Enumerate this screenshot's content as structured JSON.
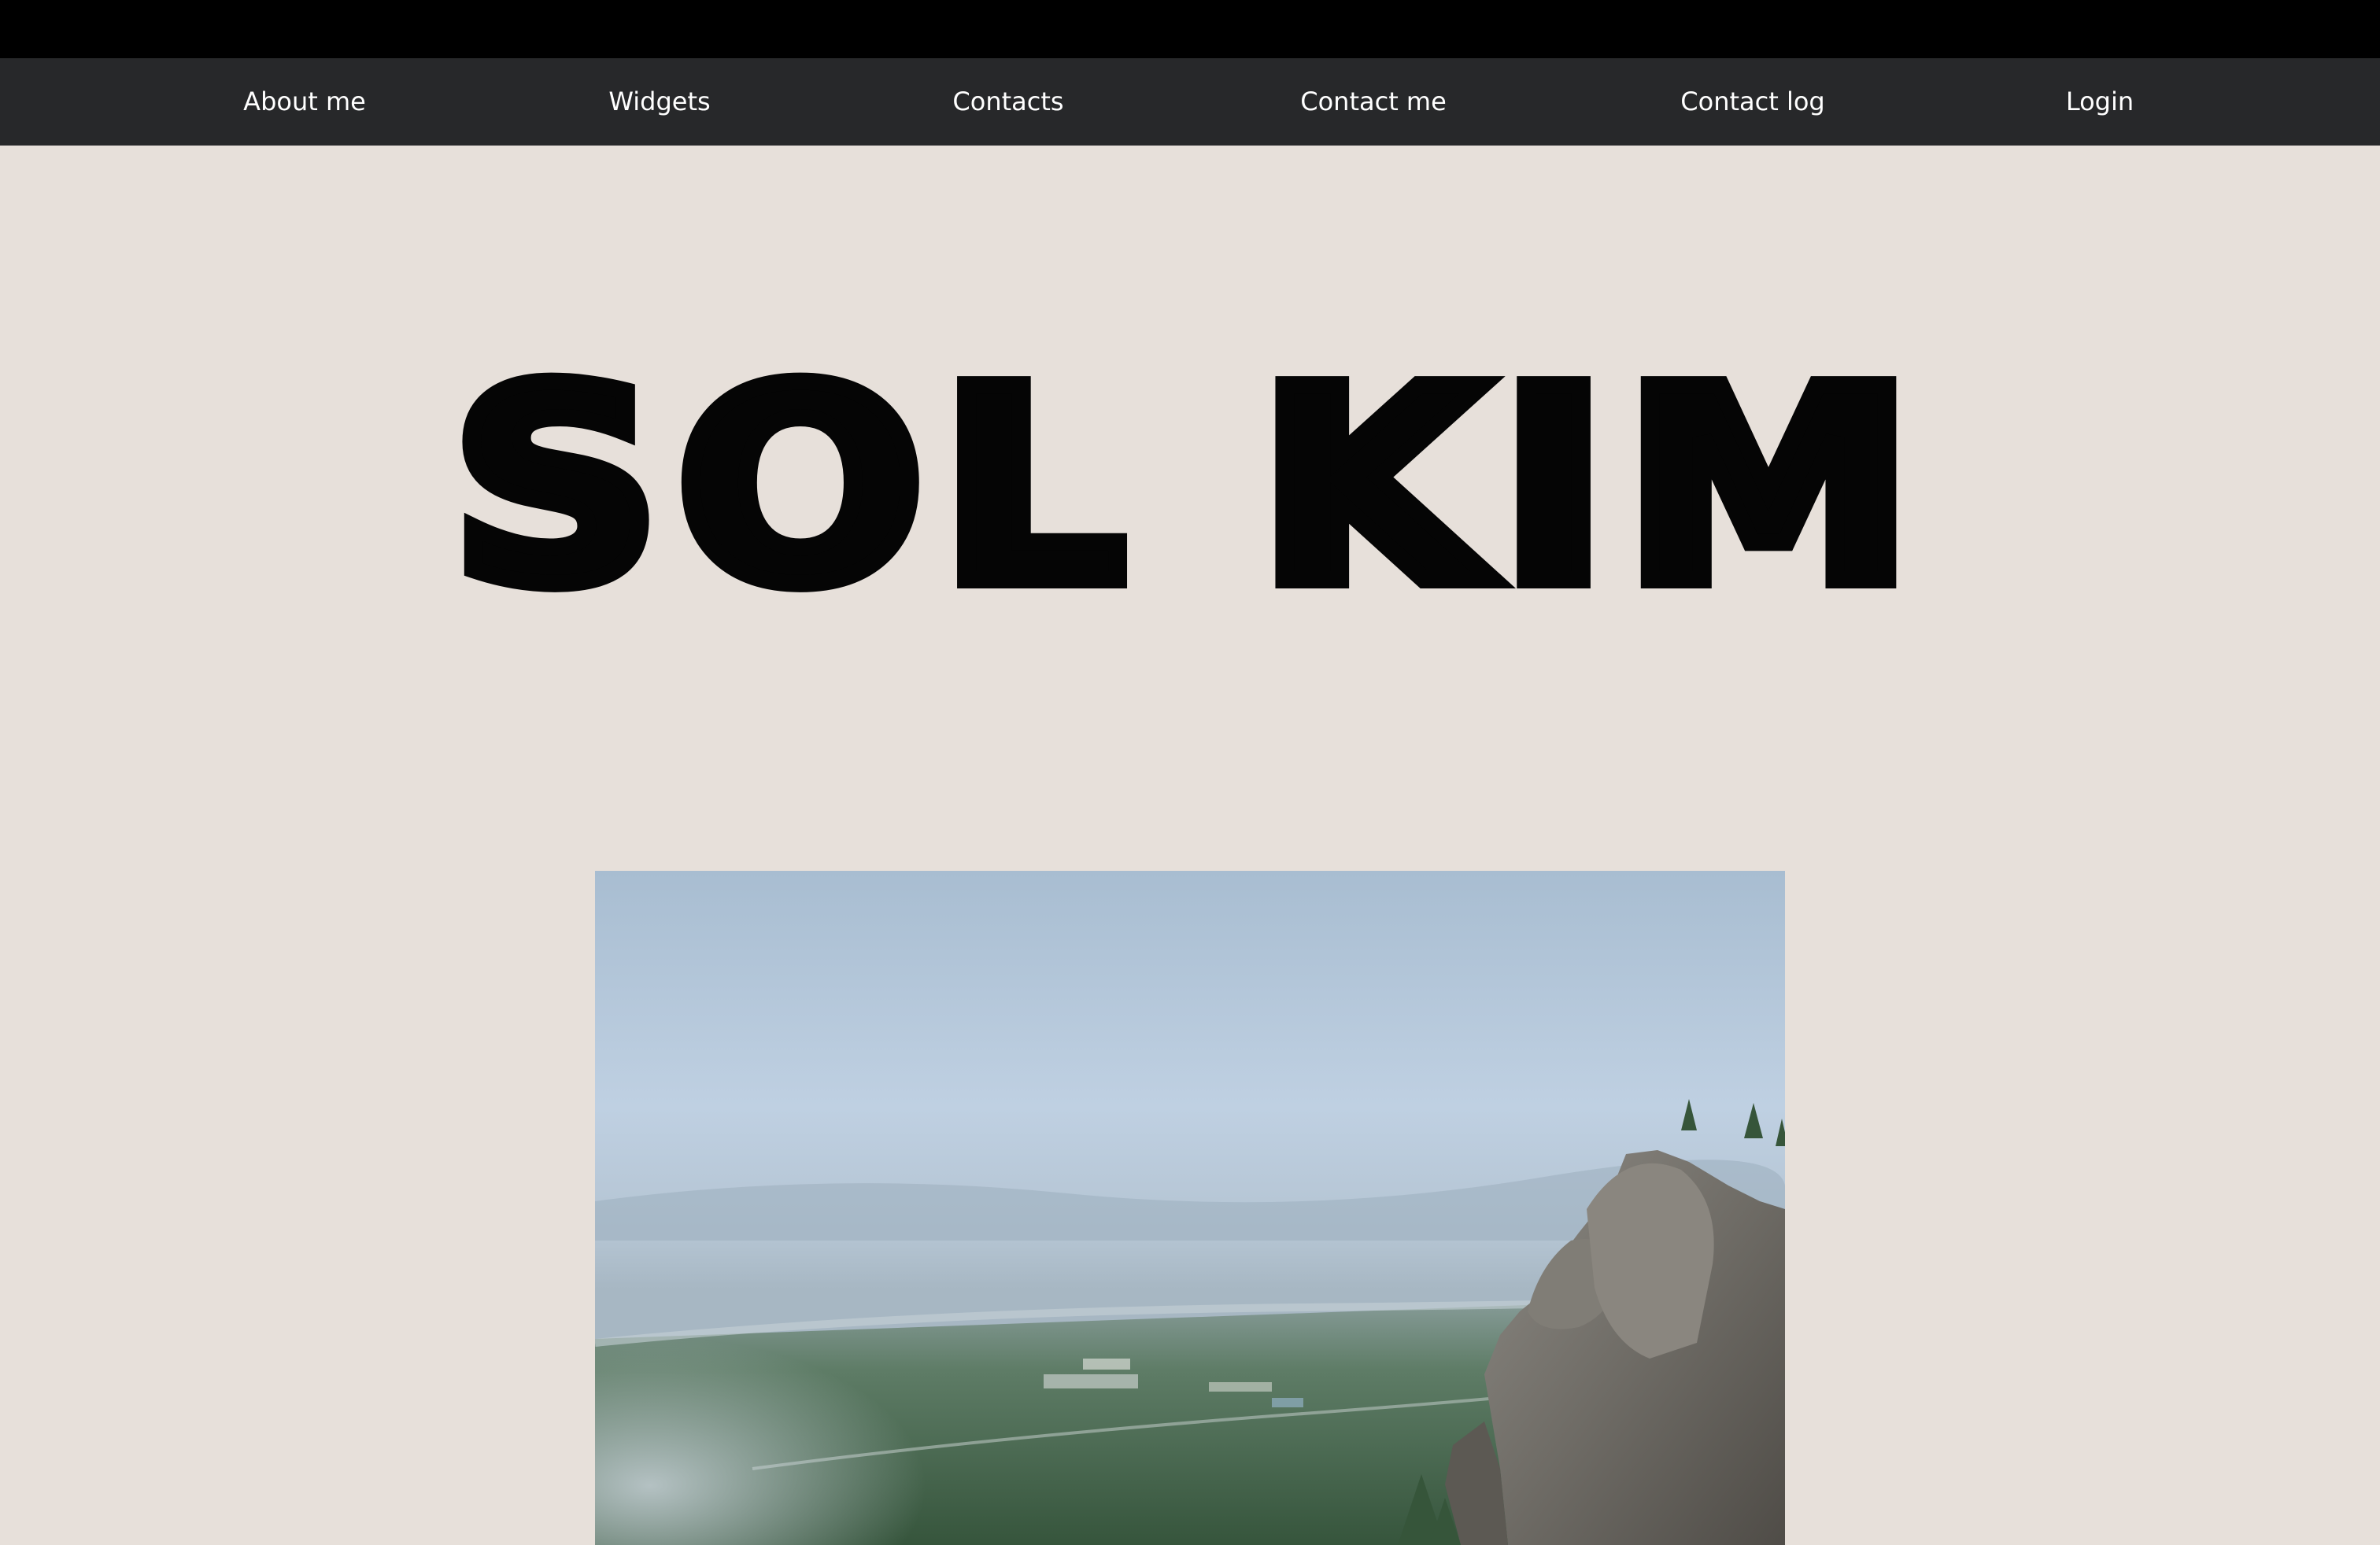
{
  "nav": {
    "items": [
      "About me",
      "Widgets",
      "Contacts",
      "Contact me",
      "Contact log",
      "Login"
    ],
    "background": "#27282a",
    "text_color": "#ffffff"
  },
  "hero": {
    "title": "SOL KIM"
  },
  "photo": {
    "description_icon": "landscape-photo"
  },
  "colors": {
    "page_background": "#e7e0da",
    "top_bar": "#000000",
    "title": "#050505"
  }
}
